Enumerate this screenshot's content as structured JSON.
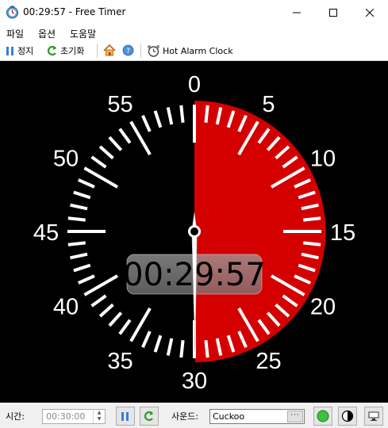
{
  "window": {
    "title": "00:29:57 - Free Timer"
  },
  "menu": {
    "items": [
      "파일",
      "옵션",
      "도움말"
    ]
  },
  "toolbar": {
    "pause_label": "정지",
    "reset_label": "초기화",
    "hot_alarm_label": "Hot Alarm Clock"
  },
  "dial": {
    "display_time": "00:29:57",
    "labels": [
      "0",
      "5",
      "10",
      "15",
      "20",
      "25",
      "30",
      "35",
      "40",
      "45",
      "50",
      "55"
    ],
    "remaining_minutes": 29.95,
    "scale_minutes": 60,
    "accent_color": "#d40000"
  },
  "bottom": {
    "time_label": "시간:",
    "time_value": "00:30:00",
    "sound_label": "사운드:",
    "sound_value": "Cuckoo",
    "browse_label": "···"
  }
}
